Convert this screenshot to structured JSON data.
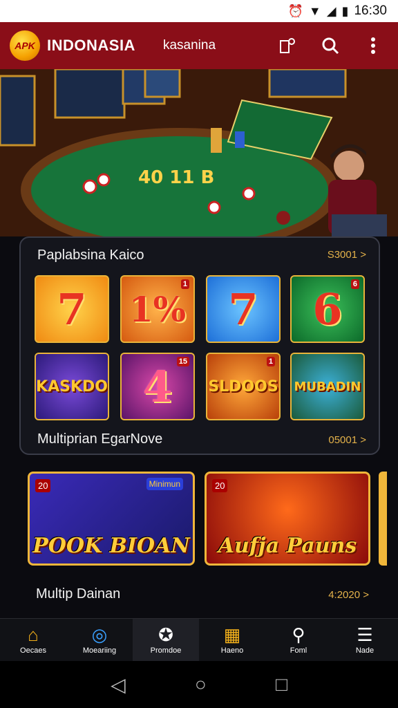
{
  "status_bar": {
    "time": "16:30"
  },
  "app_bar": {
    "logo_text": "APK",
    "brand": "INDONASIA",
    "user": "kasanina",
    "icons": [
      "notification-icon",
      "search-icon",
      "more-vertical-icon"
    ]
  },
  "hero": {
    "table_text": "40 11 B"
  },
  "section1": {
    "title": "Paplabsina Kaico",
    "more": "S3001 >",
    "tiles": [
      {
        "label": "7",
        "badge": ""
      },
      {
        "label": "1%",
        "badge": "1"
      },
      {
        "label": "7",
        "badge": ""
      },
      {
        "label": "6",
        "badge": "6"
      },
      {
        "label": "KASKDO",
        "badge": ""
      },
      {
        "label": "4",
        "badge": "15"
      },
      {
        "label": "SLDOOS",
        "badge": "1"
      },
      {
        "label": "MUBADIN",
        "badge": ""
      }
    ],
    "sub_title": "Multiprian EgarNove",
    "sub_more": "05001 >"
  },
  "banners": [
    {
      "title": "POOK BIOAN",
      "number": "20",
      "chip": "Minimun"
    },
    {
      "title": "Aufja Pauns",
      "number": "20",
      "chip": ""
    }
  ],
  "section3": {
    "title": "Multip Dainan",
    "more": "4:2020 >"
  },
  "bottom_nav": [
    {
      "label": "Oecaes",
      "icon": "home-icon"
    },
    {
      "label": "Moeariing",
      "icon": "target-icon"
    },
    {
      "label": "Promdoe",
      "icon": "gamepad-icon"
    },
    {
      "label": "Haeno",
      "icon": "grid-icon"
    },
    {
      "label": "Foml",
      "icon": "search-icon"
    },
    {
      "label": "Nade",
      "icon": "menu-icon"
    }
  ]
}
